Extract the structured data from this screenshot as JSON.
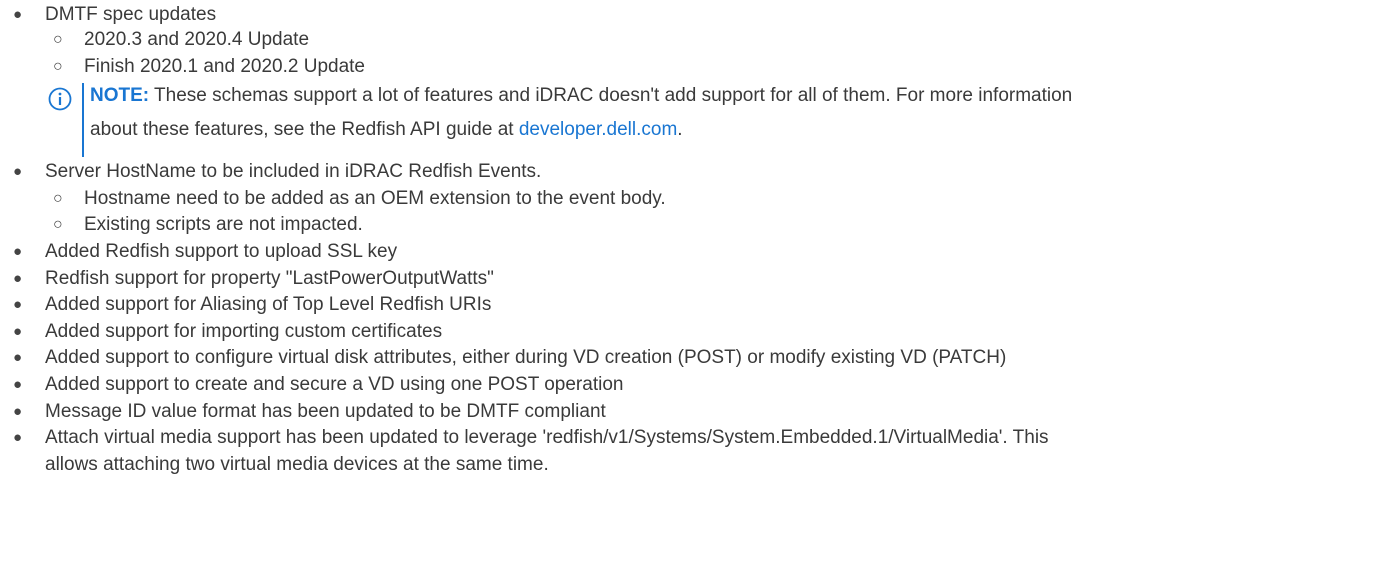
{
  "items": [
    {
      "text": "DMTF spec updates",
      "subitems": [
        {
          "text": "2020.3 and 2020.4 Update"
        },
        {
          "text": "Finish 2020.1 and 2020.2 Update"
        }
      ],
      "note": {
        "label": "NOTE:",
        "text_line1": "These schemas support a lot of features and iDRAC doesn't add support for all of them. For more information",
        "text_line2_before": "about these features, see the Redfish API guide at ",
        "link_text": "developer.dell.com",
        "text_line2_after": "."
      }
    },
    {
      "text": "Server HostName to be included in iDRAC Redfish Events.",
      "subitems": [
        {
          "text": "Hostname need to be added as an OEM extension to the event body."
        },
        {
          "text": "Existing scripts are not impacted."
        }
      ]
    },
    {
      "text": "Added Redfish support to upload SSL key"
    },
    {
      "text": "Redfish support for property \"LastPowerOutputWatts\""
    },
    {
      "text": "Added support for Aliasing of Top Level Redfish URIs"
    },
    {
      "text": "Added support for importing custom certificates"
    },
    {
      "text": "Added support to configure virtual disk attributes, either during VD creation (POST) or modify existing VD (PATCH)"
    },
    {
      "text": "Added support to create and secure a VD using one POST operation"
    },
    {
      "text": "Message ID value format has been updated to be DMTF compliant"
    },
    {
      "text_line1": "Attach virtual media support has been updated to leverage 'redfish/v1/Systems/System.Embedded.1/VirtualMedia'. This",
      "text_line2": "allows attaching two virtual media devices at the same time."
    }
  ],
  "icons": {
    "bullet": "filled-circle-bullet",
    "sub_bullet": "hollow-circle-bullet",
    "note": "info-circle-icon"
  },
  "colors": {
    "text": "#3a3a3a",
    "accent": "#1976d2"
  }
}
